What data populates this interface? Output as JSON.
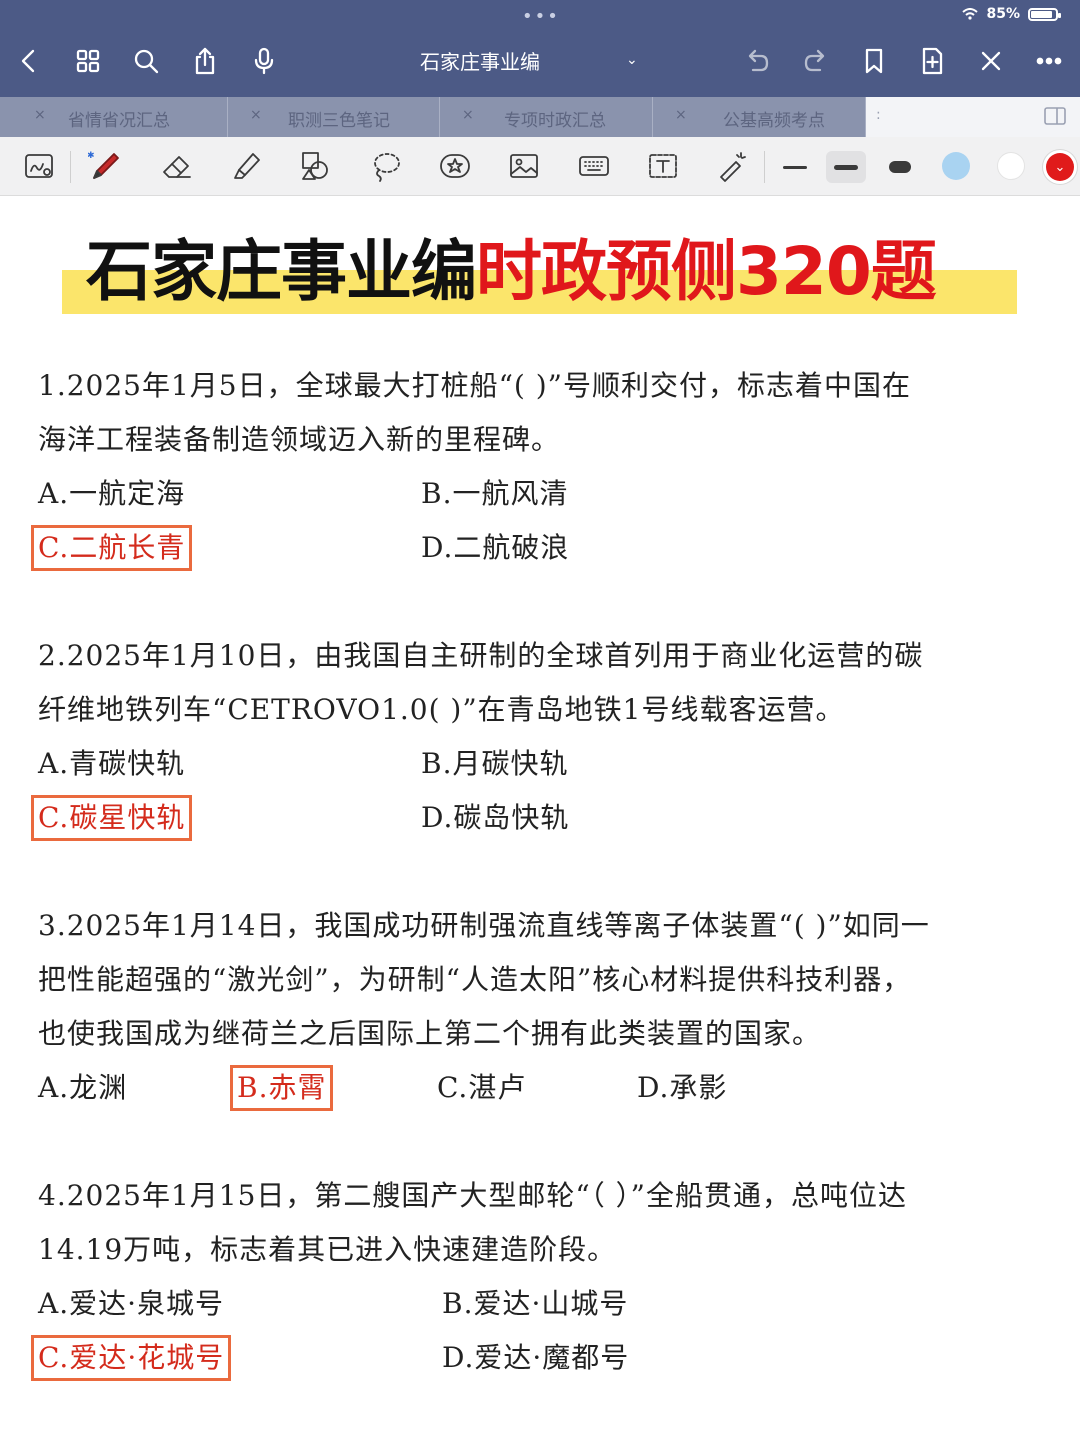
{
  "status_bar": {
    "dots": "•••",
    "battery_text": "85%"
  },
  "app_bar": {
    "title": "石家庄事业编",
    "title_caret": "⌄"
  },
  "tabs": [
    {
      "label": "省情省况汇总",
      "close": "×"
    },
    {
      "label": "职测三色笔记",
      "close": "×"
    },
    {
      "label": "专项时政汇总",
      "close": "×"
    },
    {
      "label": "公基高频考点",
      "close": "×"
    },
    {
      "label": "",
      "close": ":"
    }
  ],
  "colors": {
    "app_bar": "#4c5a86",
    "banner_highlight": "#fbe56b",
    "banner_red": "#e0171b",
    "answer_text": "#d42b1c",
    "answer_border": "#ea6a3e",
    "swatch_blue": "#a9d3f1",
    "swatch_white": "#ffffff",
    "swatch_red": "#e01b1b"
  },
  "banner": {
    "black_part": "石家庄事业编",
    "red_part": "时政预侧320题"
  },
  "questions": [
    {
      "lines": [
        "1.2025年1月5日，全球最大打桩船“(    )”号顺利交付，标志着中国在",
        "海洋工程装备制造领域迈入新的里程碑。"
      ],
      "options": [
        "A.一航定海",
        "B.一航风清",
        "C.二航长青",
        "D.二航破浪"
      ],
      "answer_index": 2
    },
    {
      "lines": [
        "2.2025年1月10日，由我国自主研制的全球首列用于商业化运营的碳",
        "纤维地铁列车“CETROVO1.0(    )”在青岛地铁1号线载客运营。"
      ],
      "options": [
        "A.青碳快轨",
        "B.月碳快轨",
        "C.碳星快轨",
        "D.碳岛快轨"
      ],
      "answer_index": 2
    },
    {
      "lines": [
        "3.2025年1月14日，我国成功研制强流直线等离子体装置“(    )”如同一",
        "把性能超强的“激光剑”，为研制“人造太阳”核心材料提供科技利器，",
        "也使我国成为继荷兰之后国际上第二个拥有此类装置的国家。"
      ],
      "options": [
        "A.龙渊",
        "B.赤霄",
        "C.湛卢",
        "D.承影"
      ],
      "answer_index": 1
    },
    {
      "lines": [
        "4.2025年1月15日，第二艘国产大型邮轮“（    ）”全船贯通，总吨位达",
        "14.19万吨，标志着其已进入快速建造阶段。"
      ],
      "options": [
        "A.爱达·泉城号",
        "B.爱达·山城号",
        "C.爱达·花城号",
        "D.爱达·魔都号"
      ],
      "answer_index": 2
    }
  ]
}
